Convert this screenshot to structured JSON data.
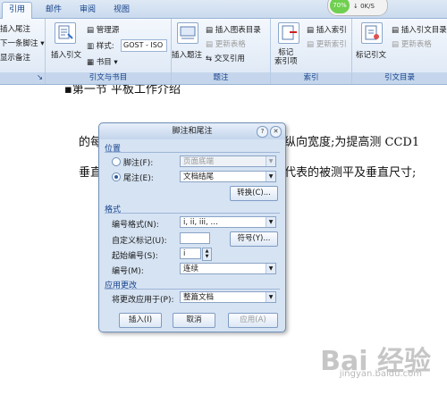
{
  "tabs": [
    "引用",
    "邮件",
    "审阅",
    "视图"
  ],
  "netmeter": {
    "percent": "70%",
    "speed": "0K/S"
  },
  "ribbon": {
    "left_items": [
      "插入尾注",
      "下一条脚注 ▾",
      "显示备注"
    ],
    "insert_citation": "插入引文",
    "manage_sources": "管理源",
    "style_label": "样式:",
    "style_value": "GOST - ISO",
    "bibliography": "书目 ▾",
    "group_citations": "引文与书目",
    "insert_caption": "插入题注",
    "insert_table_figures": "插入图表目录",
    "update_table": "更新表格",
    "cross_reference": "交叉引用",
    "group_captions": "题注",
    "mark_entry": "标记\n索引项",
    "insert_index": "插入索引",
    "update_index": "更新索引",
    "group_index": "索引",
    "mark_citation": "标记引文",
    "insert_toa": "插入引文目录",
    "update_toa": "更新表格",
    "group_toa": "引文目录"
  },
  "doc": {
    "heading": "第一节 平板工作介绍",
    "line1_left": "的每",
    "line1_right": "纵向宽度;为提高测 CCD1",
    "line2_left": "垂直",
    "line2_right": "代表的被测平及垂直尺寸;",
    "watermark": "Bai 经验",
    "watermark_url": "jingyan.baidu.com"
  },
  "dialog": {
    "title": "脚注和尾注",
    "help": "?",
    "close": "✕",
    "section_location": "位置",
    "footnote_label": "脚注(F):",
    "footnote_value": "页面底端",
    "endnote_label": "尾注(E):",
    "endnote_value": "文档结尾",
    "convert_button": "转换(C)...",
    "section_format": "格式",
    "number_format_label": "编号格式(N):",
    "number_format_value": "i, ii, iii, …",
    "custom_mark_label": "自定义标记(U):",
    "custom_mark_value": "",
    "symbol_button": "符号(Y)...",
    "start_at_label": "起始编号(S):",
    "start_at_value": "i",
    "numbering_label": "编号(M):",
    "numbering_value": "连续",
    "section_apply": "应用更改",
    "apply_to_label": "将更改应用于(P):",
    "apply_to_value": "整篇文档",
    "insert_button": "插入(I)",
    "cancel_button": "取消",
    "apply_button": "应用(A)"
  }
}
